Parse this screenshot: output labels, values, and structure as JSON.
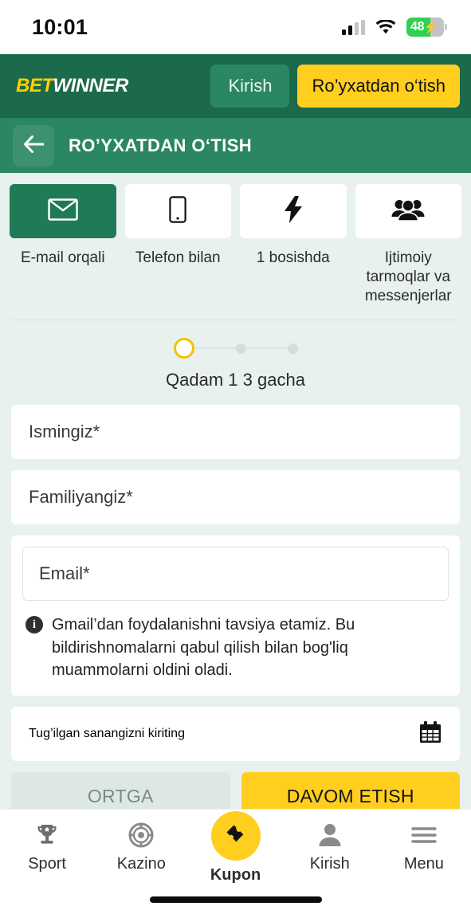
{
  "status_bar": {
    "time": "10:01",
    "battery_level": "48",
    "battery_charging": true,
    "signal_icon": "cellular-signal-icon",
    "wifi_icon": "wifi-icon",
    "battery_icon": "battery-icon"
  },
  "brand_header": {
    "logo_first": "BET",
    "logo_second": "WINNER",
    "login_label": "Kirish",
    "register_label": "Ro’yxatdan o‘tish",
    "background_color": "#1B6A4B",
    "accent_color": "#FFCE1F"
  },
  "sub_header": {
    "back_icon": "arrow-left-icon",
    "title": "RO’YXATDAN O‘TISH",
    "background_color": "#2A8761"
  },
  "methods": [
    {
      "id": "email",
      "icon": "envelope-icon",
      "label": "E-mail orqali",
      "active": true
    },
    {
      "id": "phone",
      "icon": "mobile-phone-icon",
      "label": "Telefon bilan",
      "active": false
    },
    {
      "id": "one_click",
      "icon": "lightning-bolt-icon",
      "label": "1 bosishda",
      "active": false
    },
    {
      "id": "social",
      "icon": "people-group-icon",
      "label": "Ijtimoiy tarmoqlar va messenjerlar",
      "active": false
    }
  ],
  "steps": {
    "current": 1,
    "total": 3,
    "label": "Qadam 1 3 gacha",
    "current_color": "#F2C200",
    "inactive_color": "#cfe0da"
  },
  "form": {
    "first_name_placeholder": "Ismingiz*",
    "last_name_placeholder": "Familiyangiz*",
    "email_placeholder": "Email*",
    "email_note": "Gmail’dan foydalanishni tavsiya etamiz. Bu bildirishnomalarni qabul qilish bilan bog'liq muammolarni oldini oladi.",
    "info_glyph": "i",
    "birthdate_placeholder": "Tug’ilgan sanangizni kiriting",
    "calendar_icon": "calendar-icon"
  },
  "actions": {
    "back_label": "ORTGA",
    "continue_label": "DAVOM ETISH"
  },
  "bottom_nav": [
    {
      "id": "sport",
      "icon": "trophy-icon",
      "label": "Sport",
      "highlight": false
    },
    {
      "id": "kazino",
      "icon": "casino-chip-icon",
      "label": "Kazino",
      "highlight": false
    },
    {
      "id": "kupon",
      "icon": "ticket-icon",
      "label": "Kupon",
      "highlight": true
    },
    {
      "id": "kirish",
      "icon": "person-icon",
      "label": "Kirish",
      "highlight": false
    },
    {
      "id": "menu",
      "icon": "hamburger-menu-icon",
      "label": "Menu",
      "highlight": false
    }
  ]
}
